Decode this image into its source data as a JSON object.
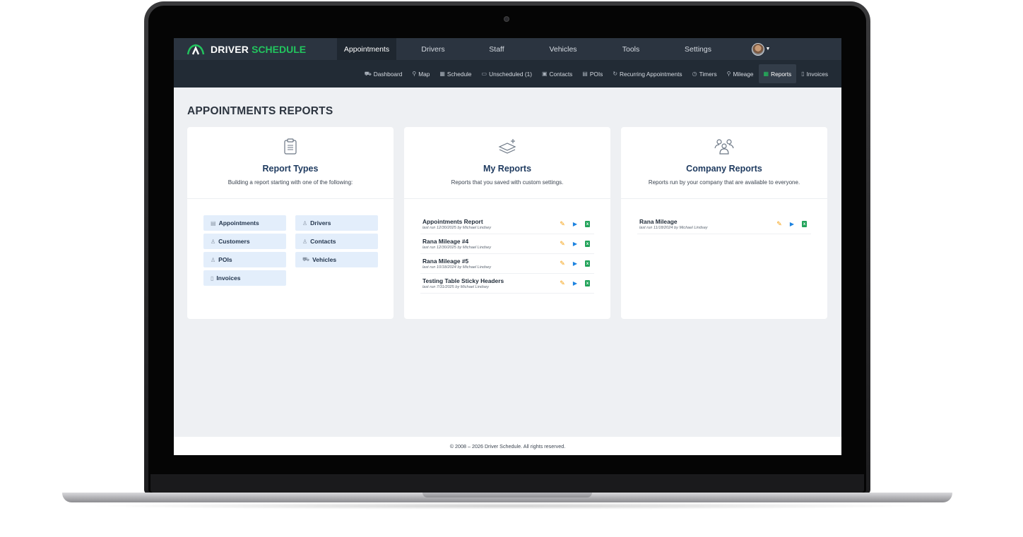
{
  "brand": {
    "part1": "DRIVER",
    "part2": "SCHEDULE",
    "accent": "#22c55e"
  },
  "topnav": [
    {
      "label": "Appointments",
      "active": true
    },
    {
      "label": "Drivers"
    },
    {
      "label": "Staff"
    },
    {
      "label": "Vehicles"
    },
    {
      "label": "Tools"
    },
    {
      "label": "Settings"
    }
  ],
  "subnav": [
    {
      "label": "Dashboard",
      "icon": "car-icon"
    },
    {
      "label": "Map",
      "icon": "pin-icon"
    },
    {
      "label": "Schedule",
      "icon": "calendar-icon"
    },
    {
      "label": "Unscheduled (1)",
      "icon": "calendar-blank-icon"
    },
    {
      "label": "Contacts",
      "icon": "contact-card-icon"
    },
    {
      "label": "POIs",
      "icon": "building-icon"
    },
    {
      "label": "Recurring Appointments",
      "icon": "repeat-icon"
    },
    {
      "label": "Timers",
      "icon": "clock-icon"
    },
    {
      "label": "Mileage",
      "icon": "pin-icon"
    },
    {
      "label": "Reports",
      "icon": "table-icon",
      "active": true
    },
    {
      "label": "Invoices",
      "icon": "document-icon"
    }
  ],
  "page_title": "APPOINTMENTS REPORTS",
  "cards": {
    "report_types": {
      "title": "Report Types",
      "subtitle": "Building a report starting with one of the following:",
      "types": [
        {
          "label": "Appointments",
          "icon": "clipboard-icon"
        },
        {
          "label": "Drivers",
          "icon": "person-icon"
        },
        {
          "label": "Customers",
          "icon": "person-icon"
        },
        {
          "label": "Contacts",
          "icon": "person-icon"
        },
        {
          "label": "POIs",
          "icon": "person-icon"
        },
        {
          "label": "Vehicles",
          "icon": "car-icon"
        },
        {
          "label": "Invoices",
          "icon": "document-icon"
        }
      ]
    },
    "my_reports": {
      "title": "My Reports",
      "subtitle": "Reports that you saved with custom settings.",
      "reports": [
        {
          "name": "Appointments Report",
          "meta": "last run 12/30/2025 by Michael Lindsey"
        },
        {
          "name": "Rana Mileage #4",
          "meta": "last run 12/30/2025 by Michael Lindsey"
        },
        {
          "name": "Rana Mileage #5",
          "meta": "last run 10/18/2024 by Michael Lindsey"
        },
        {
          "name": "Testing Table Sticky Headers",
          "meta": "last run 7/31/2025 by Michael Lindsey"
        }
      ]
    },
    "company_reports": {
      "title": "Company Reports",
      "subtitle": "Reports run by your company that are available to everyone.",
      "reports": [
        {
          "name": "Rana Mileage",
          "meta": "last run 11/18/2024 by Michael Lindsey"
        }
      ]
    }
  },
  "footer": {
    "text": "© 2008 – 2026 Driver Schedule. All rights reserved."
  }
}
